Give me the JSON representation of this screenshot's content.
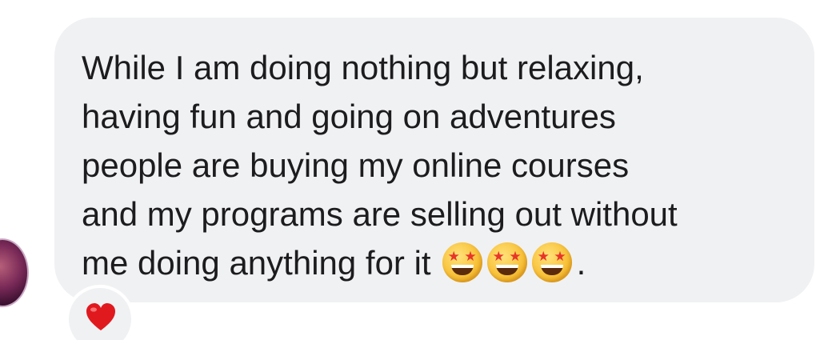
{
  "message": {
    "lines": [
      "While I am doing nothing but relaxing,",
      "having fun and going on adventures",
      "people are buying my online courses",
      "and my programs are selling out without",
      "me doing anything for it"
    ],
    "trailing_emojis": [
      "star-struck-icon",
      "star-struck-icon",
      "star-struck-icon"
    ],
    "trailing_punctuation": "."
  },
  "reaction": {
    "icon": "red-heart-icon",
    "color": "#e0191f"
  },
  "colors": {
    "bubble": "#f0f1f3",
    "text": "#1c1c1e"
  }
}
